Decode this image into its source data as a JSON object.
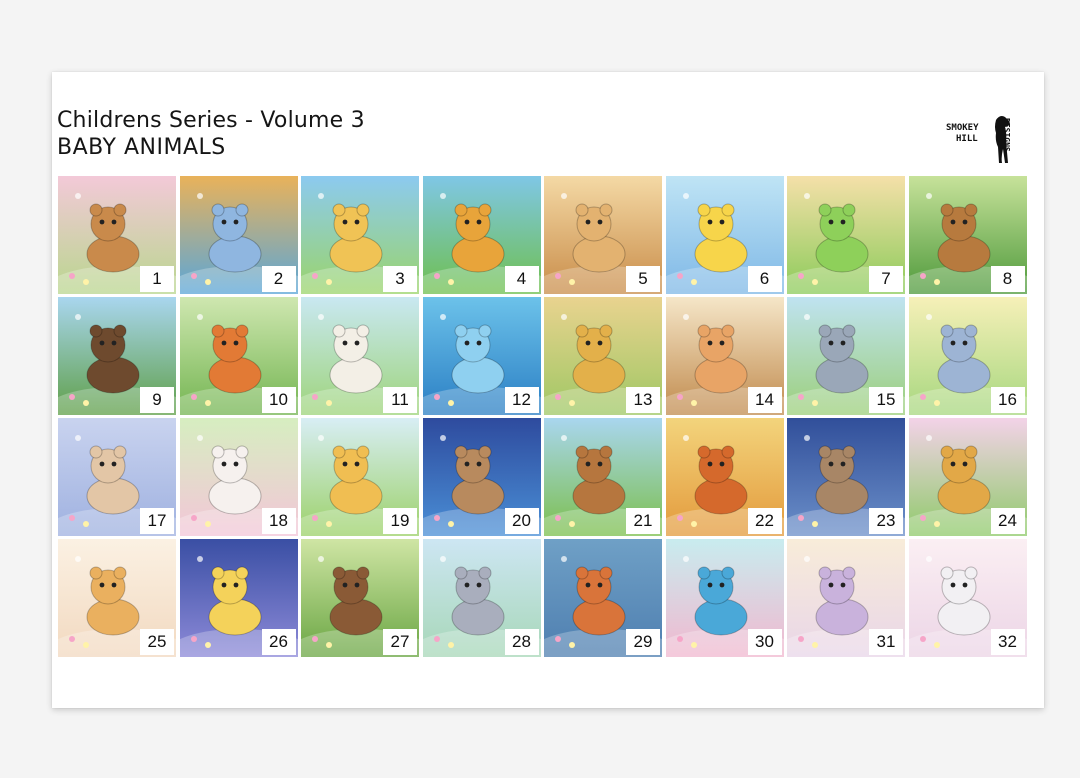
{
  "header": {
    "title": "Childrens Series - Volume 3",
    "subtitle": "BABY ANIMALS"
  },
  "logo": {
    "lines": [
      "SMOKEY",
      "HILL",
      "DESIGNS"
    ]
  },
  "tiles": [
    {
      "number": "1",
      "subject": "fawn-icon",
      "bg": [
        "#f3c9d8",
        "#b9d68e"
      ],
      "body": "#c98a4b"
    },
    {
      "number": "2",
      "subject": "owl-icon",
      "bg": [
        "#e9b25a",
        "#5aa6d8"
      ],
      "body": "#8fb6e0"
    },
    {
      "number": "3",
      "subject": "giraffe-icon",
      "bg": [
        "#8ccaf0",
        "#9bd46a"
      ],
      "body": "#f0c355"
    },
    {
      "number": "4",
      "subject": "lion-icon",
      "bg": [
        "#7fc7e6",
        "#6fbf4e"
      ],
      "body": "#e8a43a"
    },
    {
      "number": "5",
      "subject": "puppies-icon",
      "bg": [
        "#f4d9a5",
        "#c98d4a"
      ],
      "body": "#e3b270"
    },
    {
      "number": "6",
      "subject": "duckling-icon",
      "bg": [
        "#bfe4f5",
        "#7fb8e6"
      ],
      "body": "#f7d54a"
    },
    {
      "number": "7",
      "subject": "dinosaur-icon",
      "bg": [
        "#f5e0a9",
        "#8ccb5a"
      ],
      "body": "#8ed05a"
    },
    {
      "number": "8",
      "subject": "deer-family-icon",
      "bg": [
        "#c7e29a",
        "#4f9a3c"
      ],
      "body": "#b77a3e"
    },
    {
      "number": "9",
      "subject": "bear-cubs-icon",
      "bg": [
        "#a9d6ef",
        "#5f9f48"
      ],
      "body": "#6e4a2e"
    },
    {
      "number": "10",
      "subject": "fox-icon",
      "bg": [
        "#cfe7b0",
        "#74b552"
      ],
      "body": "#e27a35"
    },
    {
      "number": "11",
      "subject": "lamb-icon",
      "bg": [
        "#c9e8f2",
        "#9ed47a"
      ],
      "body": "#f3efe6"
    },
    {
      "number": "12",
      "subject": "whale-icon",
      "bg": [
        "#6cc2ea",
        "#2b7fc4"
      ],
      "body": "#8fd0f0"
    },
    {
      "number": "13",
      "subject": "giraffes-icon",
      "bg": [
        "#e9d38f",
        "#9fc764"
      ],
      "body": "#e3b04a"
    },
    {
      "number": "14",
      "subject": "kittens-icon",
      "bg": [
        "#f5e6c8",
        "#c18b4e"
      ],
      "body": "#e8a466"
    },
    {
      "number": "15",
      "subject": "koala-icon",
      "bg": [
        "#bfe3f1",
        "#9ccf7a"
      ],
      "body": "#9aa7b8"
    },
    {
      "number": "16",
      "subject": "elephant-icon",
      "bg": [
        "#f6f0b8",
        "#a7d77f"
      ],
      "body": "#9db4d4"
    },
    {
      "number": "17",
      "subject": "bunny-icon",
      "bg": [
        "#c9d3ef",
        "#9fb1e0"
      ],
      "body": "#e3c6a6"
    },
    {
      "number": "18",
      "subject": "kitten-cup-icon",
      "bg": [
        "#d6eec0",
        "#f3c6d8"
      ],
      "body": "#f6f1ee"
    },
    {
      "number": "19",
      "subject": "giraffe-tree-icon",
      "bg": [
        "#d8eef5",
        "#9cd168"
      ],
      "body": "#f0be52"
    },
    {
      "number": "20",
      "subject": "night-owl-icon",
      "bg": [
        "#2e4b9e",
        "#4a8fd6"
      ],
      "body": "#b88a5e"
    },
    {
      "number": "21",
      "subject": "calf-icon",
      "bg": [
        "#a9d6ef",
        "#7cbf4c"
      ],
      "body": "#b6763e"
    },
    {
      "number": "22",
      "subject": "squirrel-icon",
      "bg": [
        "#f3d47c",
        "#e39a3c"
      ],
      "body": "#d5692c"
    },
    {
      "number": "23",
      "subject": "owl-night-icon",
      "bg": [
        "#314f9a",
        "#6b8fc9"
      ],
      "body": "#a88666"
    },
    {
      "number": "24",
      "subject": "giraffe-meadow-icon",
      "bg": [
        "#f3d2e8",
        "#8fca6a"
      ],
      "body": "#e2a847"
    },
    {
      "number": "25",
      "subject": "puppy-bow-icon",
      "bg": [
        "#fbf1e3",
        "#f2d9c0"
      ],
      "body": "#eab05f"
    },
    {
      "number": "26",
      "subject": "bunny-moon-icon",
      "bg": [
        "#3a4fa4",
        "#8d8ad8"
      ],
      "body": "#f4d25a"
    },
    {
      "number": "27",
      "subject": "teddy-bear-icon",
      "bg": [
        "#cfe5a4",
        "#6aa643"
      ],
      "body": "#8a5a36"
    },
    {
      "number": "28",
      "subject": "elephant-balloons-icon",
      "bg": [
        "#cde6f3",
        "#a7d7b8"
      ],
      "body": "#a9aebd"
    },
    {
      "number": "29",
      "subject": "sleeping-fox-icon",
      "bg": [
        "#6fa0c6",
        "#4f7fb0"
      ],
      "body": "#d9743a"
    },
    {
      "number": "30",
      "subject": "fish-icon",
      "bg": [
        "#c8ecef",
        "#f1b8cf"
      ],
      "body": "#4aa8d8"
    },
    {
      "number": "31",
      "subject": "acorn-squirrel-icon",
      "bg": [
        "#f8ecd9",
        "#e9d6e8"
      ],
      "body": "#c9b2dc"
    },
    {
      "number": "32",
      "subject": "kitten-basket-icon",
      "bg": [
        "#fbeff3",
        "#ecd5e6"
      ],
      "body": "#f2f0f3"
    }
  ],
  "watermark": "Smokey Hill Designs"
}
